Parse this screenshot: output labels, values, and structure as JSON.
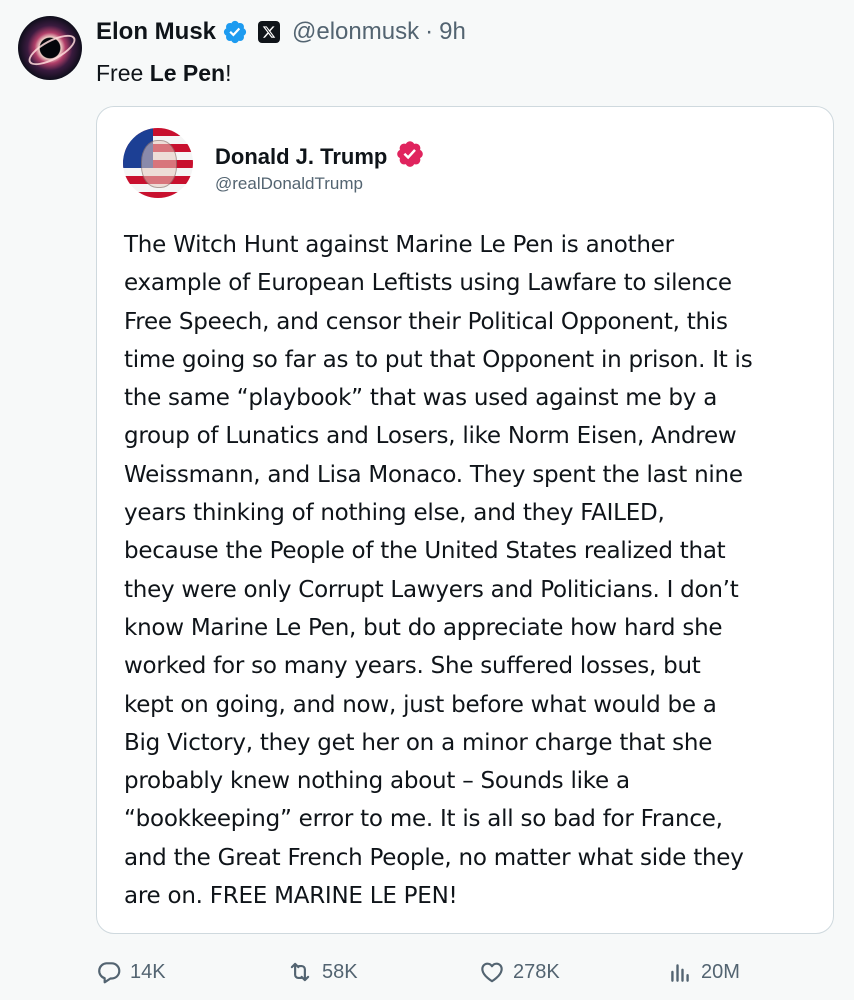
{
  "tweet": {
    "author_name": "Elon Musk",
    "author_handle": "@elonmusk",
    "separator": "·",
    "time": "9h",
    "text_prefix": "Free ",
    "text_bold": "Le Pen",
    "text_suffix": "!"
  },
  "quote": {
    "author_name": "Donald J. Trump",
    "author_handle": "@realDonaldTrump",
    "lines": [
      "The Witch Hunt against Marine Le Pen is another",
      "example of European Leftists using Lawfare to silence",
      "Free Speech, and censor their Political Opponent, this",
      "time going so far as to put that Opponent in prison. It is",
      "the same “playbook” that was used against me by a",
      "group of Lunatics and Losers, like Norm Eisen, Andrew",
      "Weissmann, and Lisa Monaco. They spent the last nine",
      "years thinking of nothing else, and they FAILED,",
      "because the People of the United States realized that",
      "they were only Corrupt Lawyers and Politicians. I don’t",
      "know Marine Le Pen, but do appreciate how hard she",
      "worked for so many years. She suffered losses, but",
      "kept on going, and now, just before what would be a",
      "Big Victory, they get her on a minor charge that she",
      "probably knew nothing about – Sounds like a",
      "“bookkeeping” error to me. It is all so bad for France,",
      "and the Great French People, no matter what side they",
      "are on. FREE MARINE LE PEN!"
    ]
  },
  "actions": {
    "replies": "14K",
    "reposts": "58K",
    "likes": "278K",
    "views": "20M"
  },
  "colors": {
    "background": "#f7f9f9",
    "text": "#0f1419",
    "secondary_text": "#536471",
    "verified_blue": "#1d9bf0",
    "verified_pink": "#e0245e",
    "card_border": "#cfd9de"
  },
  "icons": {
    "verified": "verified-check-icon",
    "x_logo": "x-logo-icon",
    "reply": "speech-bubble-icon",
    "repost": "repost-arrows-icon",
    "like": "heart-icon",
    "views": "bar-chart-icon"
  }
}
